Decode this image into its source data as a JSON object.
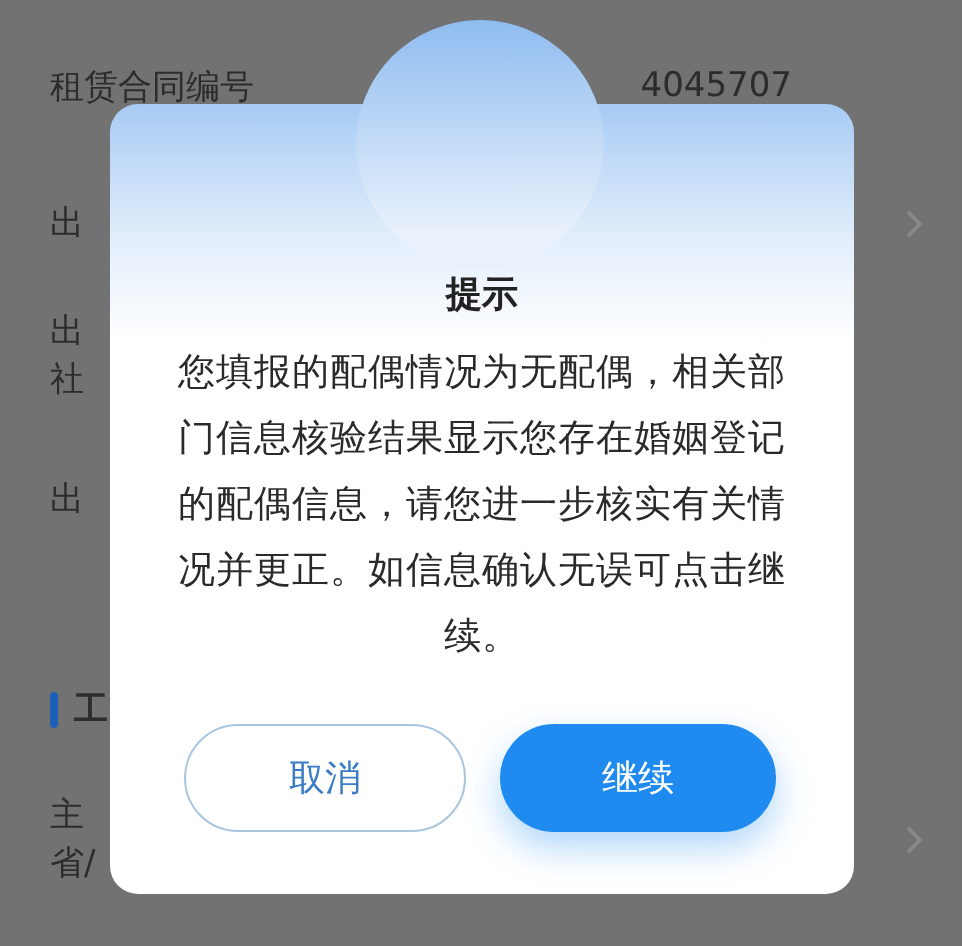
{
  "background_form": {
    "rows": [
      {
        "kind": "row",
        "lines": [
          "租赁合同编号"
        ],
        "value": "4045707"
      },
      {
        "kind": "row",
        "lines": [
          "出"
        ],
        "chevron": true
      },
      {
        "kind": "row",
        "lines": [
          "出",
          "社"
        ]
      },
      {
        "kind": "row",
        "lines": [
          "出"
        ]
      },
      {
        "kind": "section",
        "lines": [
          "工"
        ]
      },
      {
        "kind": "row",
        "lines": [
          "主",
          "省/"
        ],
        "chevron": true
      }
    ]
  },
  "dialog": {
    "title": "提示",
    "message": "您填报的配偶情况为无配偶，相关部门信息核验结果显示您存在婚姻登记的配偶信息，请您进一步核实有关情况并更正。如信息确认无误可点击继续。",
    "buttons": [
      {
        "label": "取消",
        "kind": "secondary"
      },
      {
        "label": "继续",
        "kind": "primary"
      }
    ]
  }
}
